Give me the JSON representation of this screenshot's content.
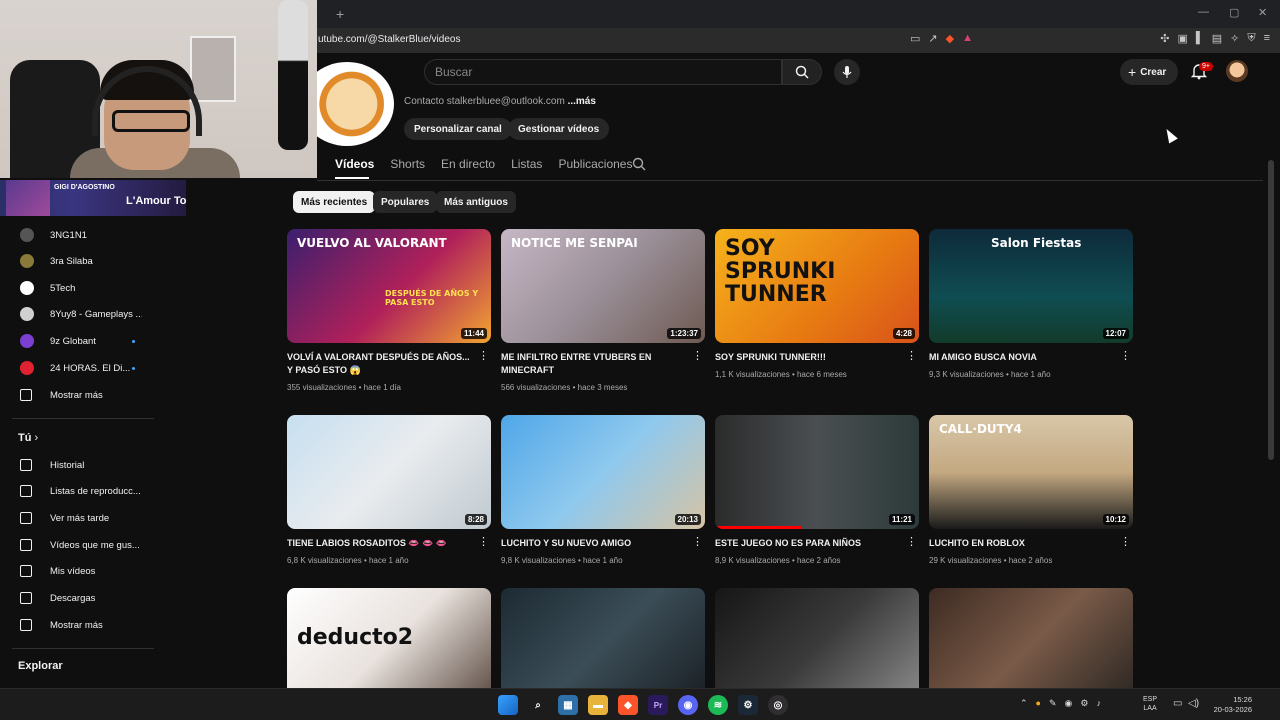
{
  "browser": {
    "new_tab": "+",
    "url": "utube.com/@StalkerBlue/videos",
    "window_controls": [
      "—",
      "▢",
      "✕"
    ]
  },
  "topbar": {
    "search_placeholder": "Buscar",
    "create_label": "Crear",
    "notifications_badge": "9+"
  },
  "channel": {
    "contact_prefix": "Contacto stalkerbluee@outlook.com",
    "contact_more": "...más",
    "customize_button": "Personalizar canal",
    "manage_button": "Gestionar vídeos",
    "tabs": [
      "Vídeos",
      "Shorts",
      "En directo",
      "Listas",
      "Publicaciones"
    ],
    "active_tab": "Vídeos"
  },
  "now_playing": {
    "artist": "GIGI D'AGOSTINO",
    "title": "L'Amour To"
  },
  "sidebar": {
    "subscriptions": [
      {
        "label": "3NG1N1",
        "color": "#555555",
        "live": false
      },
      {
        "label": "3ra Silaba",
        "color": "#8a7a3a",
        "live": false
      },
      {
        "label": "5Tech",
        "color": "#ffffff",
        "live": false
      },
      {
        "label": "8Yuy8 - Gameplays ...",
        "color": "#d0d0d0",
        "live": false
      },
      {
        "label": "9z Globant",
        "color": "#7b3fd1",
        "live": true
      },
      {
        "label": "24 HORAS. El Di...",
        "color": "#e0212f",
        "live": true
      }
    ],
    "show_more_1": "Mostrar más",
    "you_header": "Tú",
    "you_items": [
      {
        "label": "Historial",
        "icon": "history-icon"
      },
      {
        "label": "Listas de reproducc...",
        "icon": "playlist-icon"
      },
      {
        "label": "Ver más tarde",
        "icon": "clock-icon"
      },
      {
        "label": "Vídeos que me gus...",
        "icon": "thumbs-up-icon"
      },
      {
        "label": "Mis vídeos",
        "icon": "my-videos-icon"
      },
      {
        "label": "Descargas",
        "icon": "download-icon"
      }
    ],
    "show_more_2": "Mostrar más",
    "explore_header": "Explorar"
  },
  "filters": [
    "Más recientes",
    "Populares",
    "Más antiguos"
  ],
  "active_filter": "Más recientes",
  "videos": [
    {
      "title": "VOLVÍ A VALORANT DESPUÉS DE AÑOS... Y PASÓ ESTO 😱",
      "views": "355 visualizaciones",
      "age": "hace 1 día",
      "duration": "11:44",
      "thumb_text": "VUELVO AL VALORANT",
      "thumb_sub": "DESPUÉS DE AÑOS Y PASA ESTO",
      "bg": "linear-gradient(135deg,#3b1f6e 0%,#b0205a 55%,#f2a531 100%)",
      "progress": 0
    },
    {
      "title": "ME INFILTRO ENTRE VTUBERS EN MINECRAFT",
      "views": "566 visualizaciones",
      "age": "hace 3 meses",
      "duration": "1:23:37",
      "thumb_text": "NOTICE ME SENPAI",
      "thumb_sub": "",
      "bg": "linear-gradient(135deg,#c7b7c5 0%,#9a8f98 50%,#6e5a52 100%)",
      "progress": 0
    },
    {
      "title": "SOY SPRUNKI TUNNER!!!",
      "views": "1,1 K visualizaciones",
      "age": "hace 6 meses",
      "duration": "4:28",
      "thumb_text": "SOY SPRUNKI TUNNER",
      "thumb_sub": "",
      "bg": "linear-gradient(135deg,#f6b21b 0%,#e77a12 60%,#d8521a 100%)",
      "progress": 0
    },
    {
      "title": "MI AMIGO BUSCA NOVIA",
      "views": "9,3 K visualizaciones",
      "age": "hace 1 año",
      "duration": "12:07",
      "thumb_text": "Salon Fiestas",
      "thumb_sub": "",
      "bg": "linear-gradient(180deg,#0e2a3a 0%,#0f4d52 60%,#123b2a 100%)",
      "progress": 0
    },
    {
      "title": "TIENE LABIOS ROSADITOS 👄 👄 👄",
      "views": "6,8 K visualizaciones",
      "age": "hace 1 año",
      "duration": "8:28",
      "thumb_text": "",
      "thumb_sub": "",
      "bg": "linear-gradient(135deg,#c7dff0 0%,#e9ecef 50%,#bfc9cf 100%)",
      "progress": 0
    },
    {
      "title": "LUCHITO Y SU NUEVO AMIGO",
      "views": "9,8 K visualizaciones",
      "age": "hace 1 año",
      "duration": "20:13",
      "thumb_text": "",
      "thumb_sub": "",
      "bg": "linear-gradient(135deg,#4fa7e8 0%,#8fc9ee 50%,#d6c3a4 100%)",
      "progress": 0
    },
    {
      "title": "ESTE JUEGO NO ES PARA NIÑOS",
      "views": "8,9 K visualizaciones",
      "age": "hace 2 años",
      "duration": "11:21",
      "thumb_text": "",
      "thumb_sub": "",
      "bg": "linear-gradient(90deg,#2b2b2b 0%,#4a4f52 50%,#2d3a3a 100%)",
      "progress": 42
    },
    {
      "title": "LUCHITO EN ROBLOX",
      "views": "29 K visualizaciones",
      "age": "hace 2 años",
      "duration": "10:12",
      "thumb_text": "CALL·DUTY4",
      "thumb_sub": "",
      "bg": "linear-gradient(180deg,#d8c7a8 0%,#c4a982 50%,#1a1a1a 100%)",
      "progress": 0
    },
    {
      "title": "",
      "views": "",
      "age": "",
      "duration": "",
      "thumb_text": "deducto2",
      "thumb_sub": "",
      "bg": "linear-gradient(135deg,#ffffff 0%,#e9e2de 50%,#5a4a40 100%)",
      "progress": 0
    },
    {
      "title": "",
      "views": "",
      "age": "",
      "duration": "",
      "thumb_text": "",
      "thumb_sub": "",
      "bg": "linear-gradient(135deg,#1c2a33 0%,#3b4d57 50%,#1a1f24 100%)",
      "progress": 0
    },
    {
      "title": "",
      "views": "",
      "age": "",
      "duration": "",
      "thumb_text": "",
      "thumb_sub": "",
      "bg": "linear-gradient(135deg,#161616 0%,#3a3a3a 50%,#8a8a8a 100%)",
      "progress": 0
    },
    {
      "title": "",
      "views": "",
      "age": "",
      "duration": "",
      "thumb_text": "",
      "thumb_sub": "",
      "bg": "linear-gradient(135deg,#3d2b22 0%,#7a5a48 50%,#2a2622 100%)",
      "progress": 0
    }
  ],
  "taskbar": {
    "language": "ESP",
    "region": "LAA",
    "time": "15:26",
    "date": "20-03-2026"
  }
}
